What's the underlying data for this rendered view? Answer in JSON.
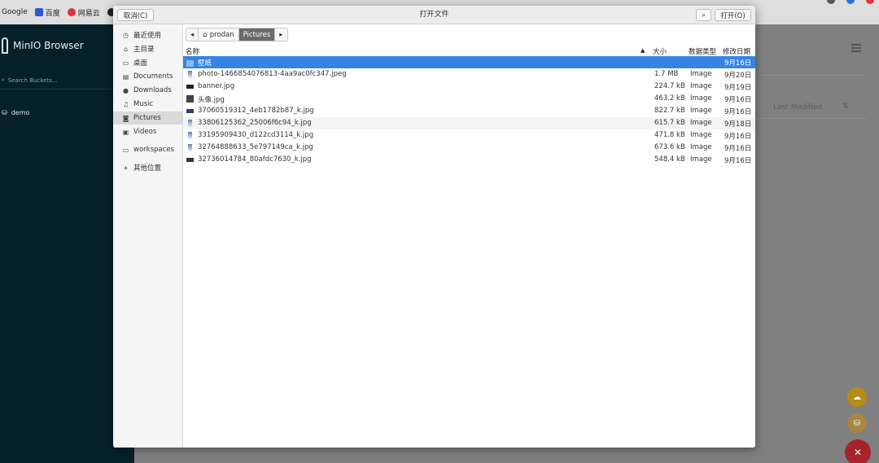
{
  "bookmarks": {
    "items": [
      {
        "label": "Google"
      },
      {
        "label": "百度"
      },
      {
        "label": "网易云"
      }
    ]
  },
  "minio": {
    "app_title": "MinIO Browser",
    "search_placeholder": "Search Buckets...",
    "bucket": "demo",
    "last_modified_header": "Last Modified"
  },
  "dialog": {
    "title": "打开文件",
    "cancel_label": "取消(C)",
    "open_label": "打开(O)",
    "places": [
      {
        "label": "最近使用",
        "icon": "clock-icon"
      },
      {
        "label": "主目录",
        "icon": "home-icon"
      },
      {
        "label": "桌面",
        "icon": "desktop-icon"
      },
      {
        "label": "Documents",
        "icon": "document-icon"
      },
      {
        "label": "Downloads",
        "icon": "download-icon"
      },
      {
        "label": "Music",
        "icon": "music-icon"
      },
      {
        "label": "Pictures",
        "icon": "camera-icon"
      },
      {
        "label": "Videos",
        "icon": "video-icon"
      },
      {
        "label": "workspaces",
        "icon": "folder-icon"
      },
      {
        "label": "其他位置",
        "icon": "plus-icon"
      }
    ],
    "pathbar": {
      "home": "prodan",
      "current": "Pictures"
    },
    "columns": {
      "name": "名称",
      "size": "大小",
      "type": "数据类型",
      "modified": "修改日期"
    },
    "files": [
      {
        "name": "壁纸",
        "size": "",
        "type": "",
        "modified": "9月16日"
      },
      {
        "name": "photo-1466854076813-4aa9ac0fc347.jpeg",
        "size": "1.7 MB",
        "type": "Image",
        "modified": "9月20日"
      },
      {
        "name": "banner.jpg",
        "size": "224.7 kB",
        "type": "Image",
        "modified": "9月19日"
      },
      {
        "name": "头像.jpg",
        "size": "463.2 kB",
        "type": "Image",
        "modified": "9月16日"
      },
      {
        "name": "37060519312_4eb1782b87_k.jpg",
        "size": "822.7 kB",
        "type": "Image",
        "modified": "9月16日"
      },
      {
        "name": "33806125362_25006f6c94_k.jpg",
        "size": "615.7 kB",
        "type": "Image",
        "modified": "9月18日"
      },
      {
        "name": "33195909430_d122cd3114_k.jpg",
        "size": "471.8 kB",
        "type": "Image",
        "modified": "9月16日"
      },
      {
        "name": "32764888633_5e797149ca_k.jpg",
        "size": "673.6 kB",
        "type": "Image",
        "modified": "9月16日"
      },
      {
        "name": "32736014784_80afdc7630_k.jpg",
        "size": "548.4 kB",
        "type": "Image",
        "modified": "9月16日"
      }
    ]
  },
  "colors": {
    "selection": "#3584e4",
    "minio_sidebar": "#06202a",
    "fab_red": "#a7232b",
    "fab_yellow": "#b58d16"
  }
}
